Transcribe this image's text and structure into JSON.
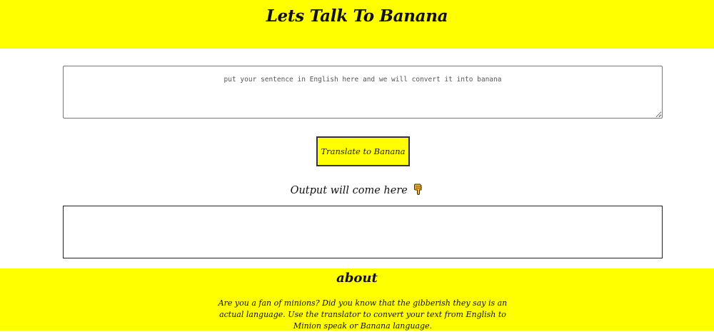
{
  "header": {
    "title": "Lets Talk To Banana"
  },
  "input": {
    "placeholder": "put your sentence in English here and we will convert it into banana",
    "value": ""
  },
  "translate_button": {
    "label": "Translate to Banana"
  },
  "output": {
    "label": "Output will come here",
    "icon": "pointing-down-hand-icon",
    "value": ""
  },
  "about": {
    "heading": "about",
    "text": "Are you a fan of minions? Did you know that the gibberish they say is an actual language. Use the translator to convert your text from English to Minion speak or Banana language."
  },
  "colors": {
    "accent": "#ffff00",
    "background": "#ffffff",
    "text": "#111111"
  }
}
